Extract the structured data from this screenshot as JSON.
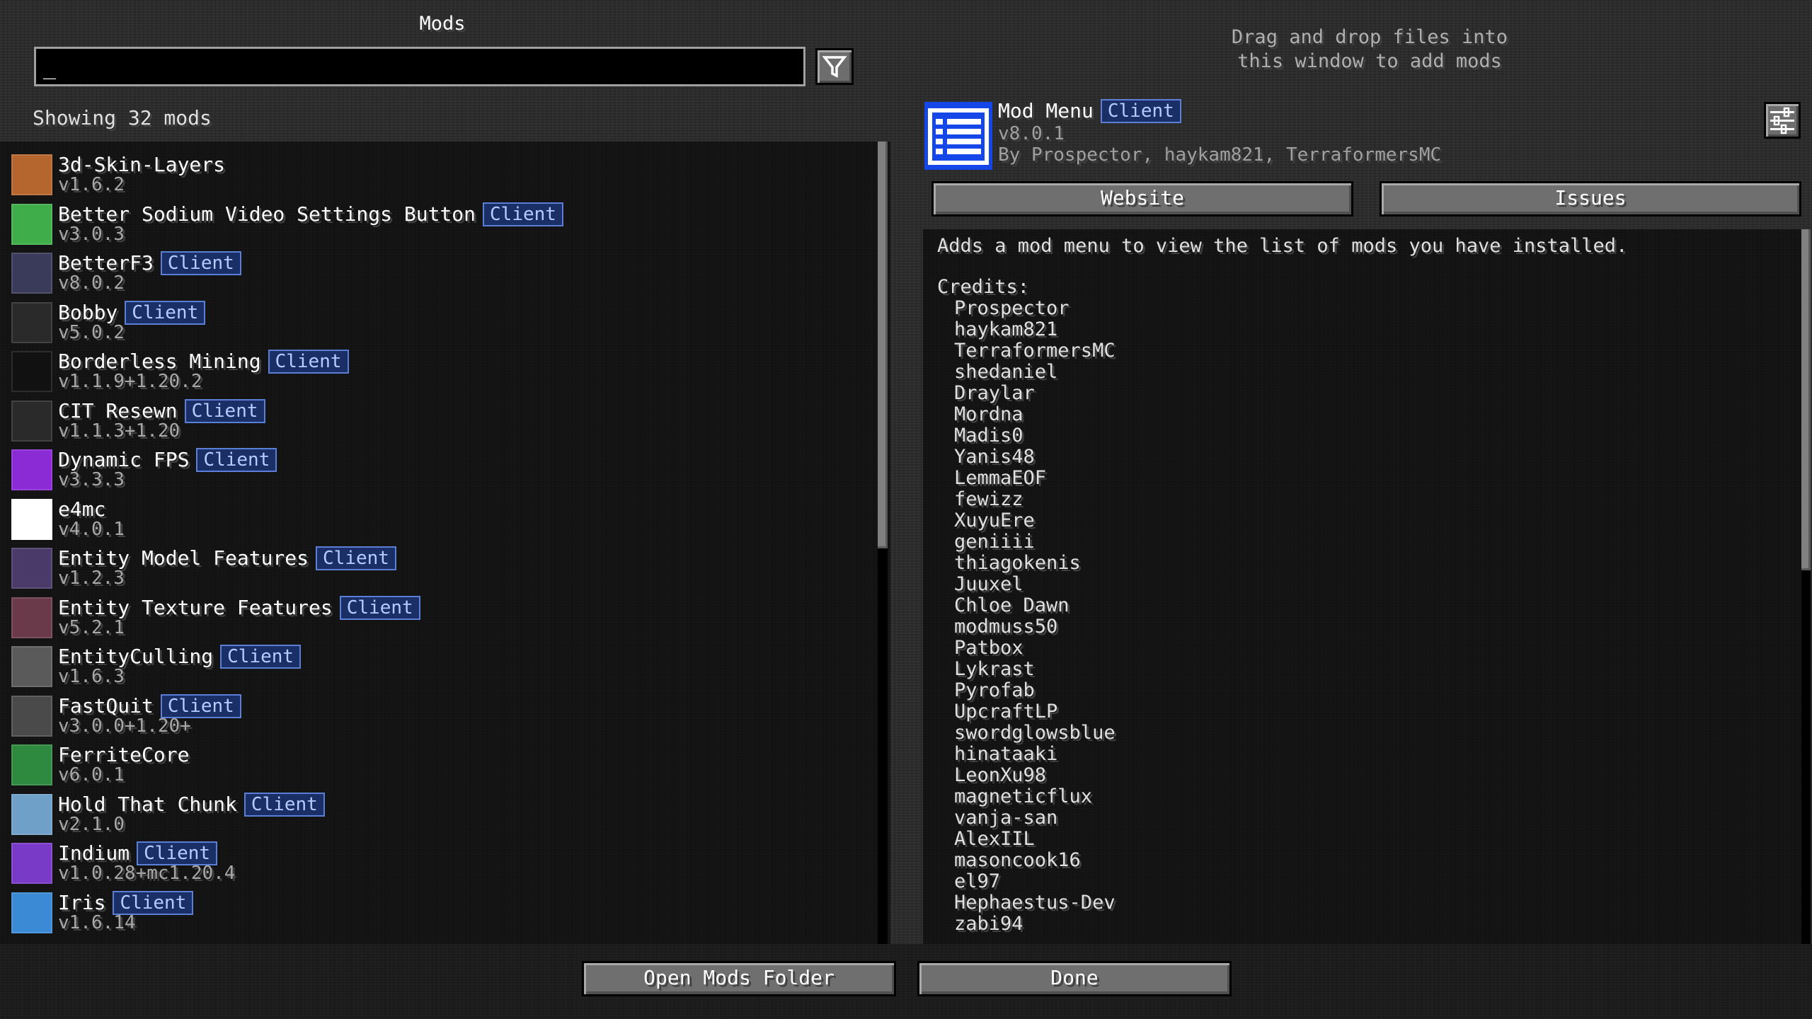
{
  "header": {
    "title": "Mods",
    "search_value": "_",
    "showing": "Showing 32 mods",
    "drag_hint_line1": "Drag and drop files into",
    "drag_hint_line2": "this window to add mods"
  },
  "mods": [
    {
      "name": "3d-Skin-Layers",
      "version": "v1.6.2",
      "client": false,
      "icon": "skin-layers-icon",
      "color": "#b5652e"
    },
    {
      "name": "Better Sodium Video Settings Button",
      "version": "v3.0.3",
      "client": true,
      "icon": "sodium-settings-icon",
      "color": "#3fae4a"
    },
    {
      "name": "BetterF3",
      "version": "v8.0.2",
      "client": true,
      "icon": "betterf3-icon",
      "color": "#3a3a5a"
    },
    {
      "name": "Bobby",
      "version": "v5.0.2",
      "client": true,
      "icon": "bobby-icon",
      "color": "#2a2a2a"
    },
    {
      "name": "Borderless Mining",
      "version": "v1.1.9+1.20.2",
      "client": true,
      "icon": "borderless-mining-icon",
      "color": "#111111"
    },
    {
      "name": "CIT Resewn",
      "version": "v1.1.3+1.20",
      "client": true,
      "icon": "cit-resewn-icon",
      "color": "#2a2a2a"
    },
    {
      "name": "Dynamic FPS",
      "version": "v3.3.3",
      "client": true,
      "icon": "dynamic-fps-icon",
      "color": "#8a2bd6"
    },
    {
      "name": "e4mc",
      "version": "v4.0.1",
      "client": false,
      "icon": "e4mc-icon",
      "color": "#ffffff"
    },
    {
      "name": "Entity Model Features",
      "version": "v1.2.3",
      "client": true,
      "icon": "emf-icon",
      "color": "#4a3a6a"
    },
    {
      "name": "Entity Texture Features",
      "version": "v5.2.1",
      "client": true,
      "icon": "etf-icon",
      "color": "#6a3a4a"
    },
    {
      "name": "EntityCulling",
      "version": "v1.6.3",
      "client": true,
      "icon": "entityculling-icon",
      "color": "#5a5a5a"
    },
    {
      "name": "FastQuit",
      "version": "v3.0.0+1.20+",
      "client": true,
      "icon": "fastquit-icon",
      "color": "#4a4a4a"
    },
    {
      "name": "FerriteCore",
      "version": "v6.0.1",
      "client": false,
      "icon": "ferritecore-icon",
      "color": "#2e8a3e"
    },
    {
      "name": "Hold That Chunk",
      "version": "v2.1.0",
      "client": true,
      "icon": "hold-that-chunk-icon",
      "color": "#6fa0c8"
    },
    {
      "name": "Indium",
      "version": "v1.0.28+mc1.20.4",
      "client": true,
      "icon": "indium-icon",
      "color": "#7a3ac8"
    },
    {
      "name": "Iris",
      "version": "v1.6.14",
      "client": true,
      "icon": "iris-icon",
      "color": "#3a8ad6"
    }
  ],
  "badge_label": "Client",
  "detail": {
    "name": "Mod Menu",
    "version": "v8.0.1",
    "authors": "By Prospector, haykam821, TerraformersMC",
    "description": "Adds a mod menu to view the list of mods you have installed.",
    "credits_label": "Credits:",
    "credits": [
      "Prospector",
      "haykam821",
      "TerraformersMC",
      "shedaniel",
      "Draylar",
      "Mordna",
      "Madis0",
      "Yanis48",
      "LemmaEOF",
      "fewizz",
      "XuyuEre",
      "geniiii",
      "thiagokenis",
      "Juuxel",
      "Chloe Dawn",
      "modmuss50",
      "Patbox",
      "Lykrast",
      "Pyrofab",
      "UpcraftLP",
      "swordglowsblue",
      "hinataaki",
      "LeonXu98",
      "magneticflux",
      "vanja-san",
      "AlexIIL",
      "masoncook16",
      "el97",
      "Hephaestus-Dev",
      "zabi94"
    ],
    "website_label": "Website",
    "issues_label": "Issues"
  },
  "footer": {
    "open_folder_label": "Open Mods Folder",
    "done_label": "Done"
  },
  "colors": {
    "badge_bg": "#1a2f66",
    "badge_border": "#5b7fd6",
    "mod_menu_icon": "#1547e8"
  }
}
